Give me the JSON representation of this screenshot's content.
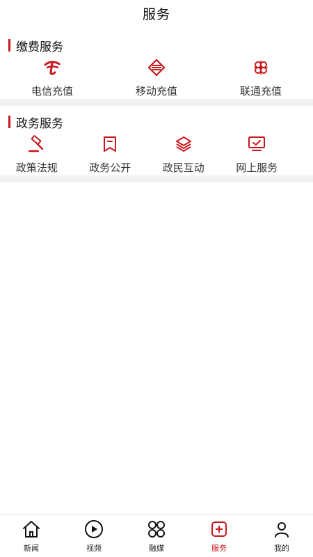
{
  "header": {
    "title": "服务"
  },
  "colors": {
    "accent": "#c8161d",
    "divider": "#f2f2f2"
  },
  "payment": {
    "title": "缴费服务",
    "items": [
      {
        "label": "电信充值",
        "icon": "telecom-icon"
      },
      {
        "label": "移动充值",
        "icon": "mobile-icon"
      },
      {
        "label": "联通充值",
        "icon": "unicom-icon"
      }
    ]
  },
  "government": {
    "title": "政务服务",
    "items": [
      {
        "label": "政策法规",
        "icon": "gavel-icon"
      },
      {
        "label": "政务公开",
        "icon": "bookmark-icon"
      },
      {
        "label": "政民互动",
        "icon": "layers-icon"
      },
      {
        "label": "网上服务",
        "icon": "monitor-check-icon"
      }
    ]
  },
  "tabbar": {
    "items": [
      {
        "label": "新闻",
        "icon": "home-icon"
      },
      {
        "label": "视频",
        "icon": "play-icon"
      },
      {
        "label": "融媒",
        "icon": "grid-icon"
      },
      {
        "label": "服务",
        "icon": "service-icon",
        "active": true
      },
      {
        "label": "我的",
        "icon": "user-icon"
      }
    ]
  }
}
